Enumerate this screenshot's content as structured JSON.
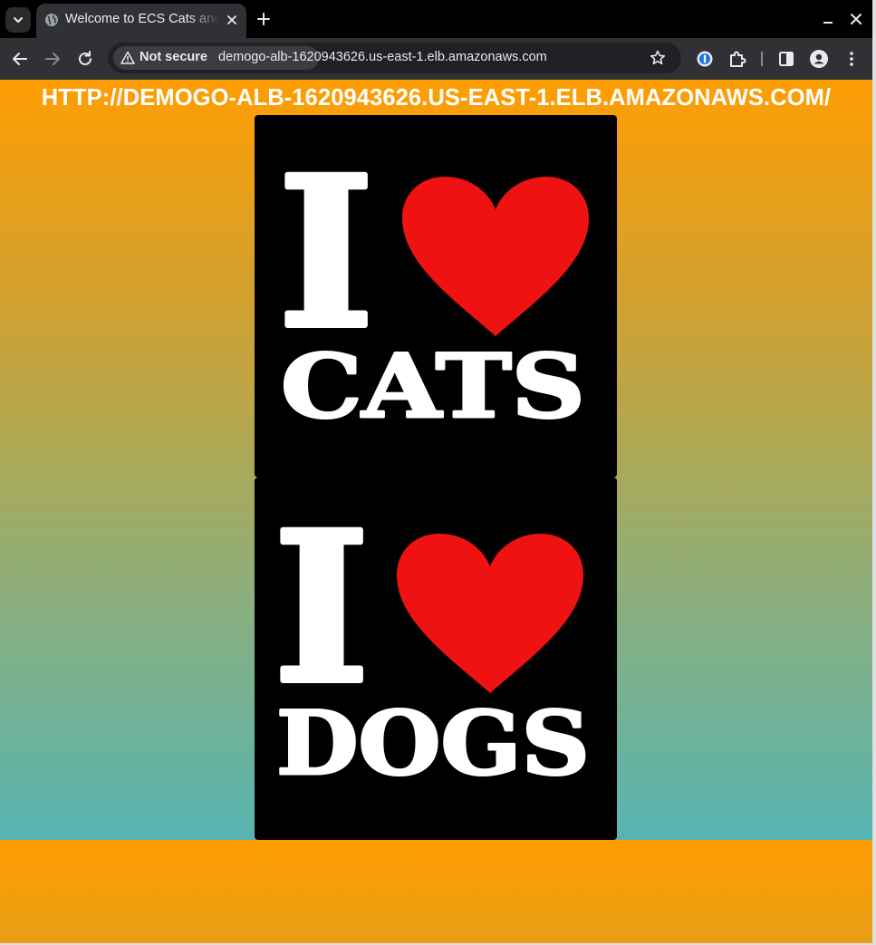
{
  "browser": {
    "tab": {
      "title": "Welcome to ECS Cats and Dogs"
    },
    "address_bar": {
      "security_label": "Not secure",
      "url": "demogo-alb-1620943626.us-east-1.elb.amazonaws.com"
    }
  },
  "page": {
    "heading": "HTTP://DEMOGO-ALB-1620943626.US-EAST-1.ELB.AMAZONAWS.COM/",
    "images": [
      {
        "big_letter": "I",
        "word": "CATS",
        "symbol": "heart"
      },
      {
        "big_letter": "I",
        "word": "DOGS",
        "symbol": "heart"
      }
    ]
  },
  "colors": {
    "gradient_top": "#fe9d03",
    "gradient_bottom": "#41b7c8",
    "heart": "#ee1212",
    "card": "#000000",
    "text": "#ffffff"
  }
}
